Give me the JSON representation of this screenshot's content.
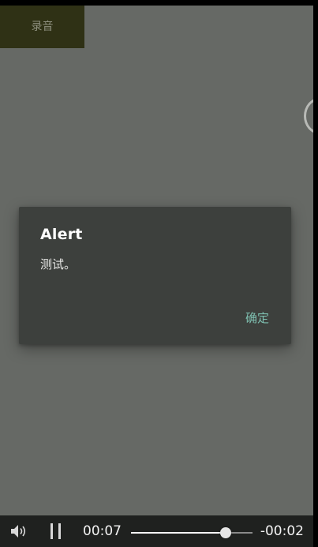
{
  "app": {
    "record_button_label": "录音"
  },
  "dialog": {
    "title": "Alert",
    "message": "测试。",
    "ok_label": "确定",
    "ok_color": "#7ebfb0"
  },
  "media_bar": {
    "volume_icon": "speaker-icon",
    "pause_icon": "pause-icon",
    "elapsed": "00:07",
    "remaining": "-00:02",
    "progress": 0.78
  }
}
